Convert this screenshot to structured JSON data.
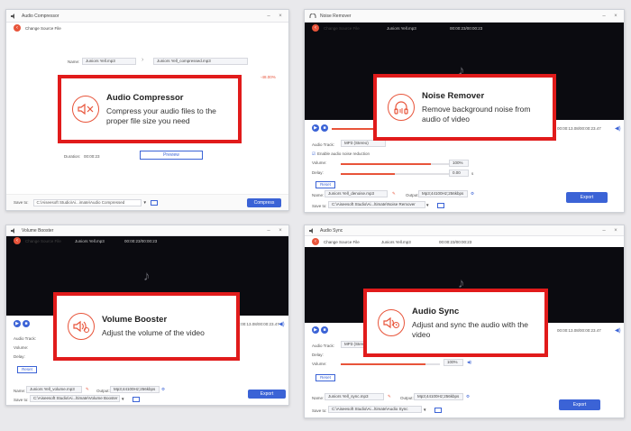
{
  "colors": {
    "accent": "#e8543a",
    "callout_border": "#e11b1b",
    "button_blue": "#3b63d6"
  },
  "panels": {
    "compressor": {
      "title": "Audio Compressor",
      "back_label": "Change Source File",
      "name_label": "Name:",
      "source_file": "Juniors Yell.mp3",
      "output_file": "Juniors Yell_compressed.mp3",
      "percent": "-48.00%",
      "duration_label": "Duration:",
      "duration": "00:00:23",
      "preview_label": "Preview",
      "save_label": "Save to:",
      "save_path": "C:\\Aiseesoft Studio\\Ai...imate\\Audio Compressed",
      "action_label": "Compress",
      "callout": {
        "icon": "audio-compressor-icon",
        "title": "Audio Compressor",
        "desc": "Compress your audio files to the proper file size you need"
      }
    },
    "noise": {
      "title": "Noise Remover",
      "back_label": "Change Source File",
      "file": "Juniors Yell.mp3",
      "file_info": "00:00:23/00:00:23",
      "time": "00:00:13.08/00:00:23.47",
      "track_label": "Audio Track:",
      "track_value": "MP3 (Stereo)",
      "checkbox_label": "Enable audio noise reduction",
      "volume_label": "Volume:",
      "volume_value": "100%",
      "delay_label": "Delay:",
      "delay_value": "0.00",
      "delay_unit": "s",
      "reset_label": "Reset",
      "name_label": "Name:",
      "name_value": "Juniors Yell_denoise.mp3",
      "output_label": "Output:",
      "output_value": "Mp3;44100Hz;256kbps",
      "save_label": "Save to:",
      "save_path": "C:\\Aiseesoft Studio\\Ai...ltimate\\Noise Remover",
      "export_label": "Export",
      "callout": {
        "icon": "noise-remover-icon",
        "title": "Noise Remover",
        "desc": "Remove background noise from audio of video"
      }
    },
    "volume": {
      "title": "Volume Booster",
      "back_label": "Change Source File",
      "file": "Juniors Yell.mp3",
      "file_info": "00:00:23/00:00:23",
      "time": "00:00:13.08/00:00:23.47",
      "track_label": "Audio Track:",
      "volume_label": "Volume:",
      "delay_label": "Delay:",
      "reset_label": "Reset",
      "name_label": "Name:",
      "name_value": "Juniors Yell_volume.mp3",
      "output_label": "Output:",
      "output_value": "Mp3;44100Hz;256kbps",
      "save_label": "Save to:",
      "save_path": "C:\\Aiseesoft Studio\\Ai...ltimate\\Volume Booster",
      "export_label": "Export",
      "callout": {
        "icon": "volume-booster-icon",
        "title": "Volume Booster",
        "desc": "Adjust the volume of the video"
      }
    },
    "sync": {
      "title": "Audio Sync",
      "back_label": "Change Source File",
      "file": "Juniors Yell.mp3",
      "file_info": "00:00:23/00:00:23",
      "time": "00:00:13.08/00:00:23.47",
      "track_label": "Audio Track:",
      "track_value": "MP3 (Stereo)",
      "delay_label": "Delay:",
      "volume_label": "Volume:",
      "volume_value": "100%",
      "reset_label": "Reset",
      "name_label": "Name:",
      "name_value": "Juniors Yell_sync.mp3",
      "output_label": "Output:",
      "output_value": "Mp3;44100Hz;256kbps",
      "save_label": "Save to:",
      "save_path": "C:\\Aiseesoft Studio\\Ai...ltimate\\Audio Sync",
      "export_label": "Export",
      "callout": {
        "icon": "audio-sync-icon",
        "title": "Audio Sync",
        "desc": "Adjust and sync the audio with the video"
      }
    }
  }
}
